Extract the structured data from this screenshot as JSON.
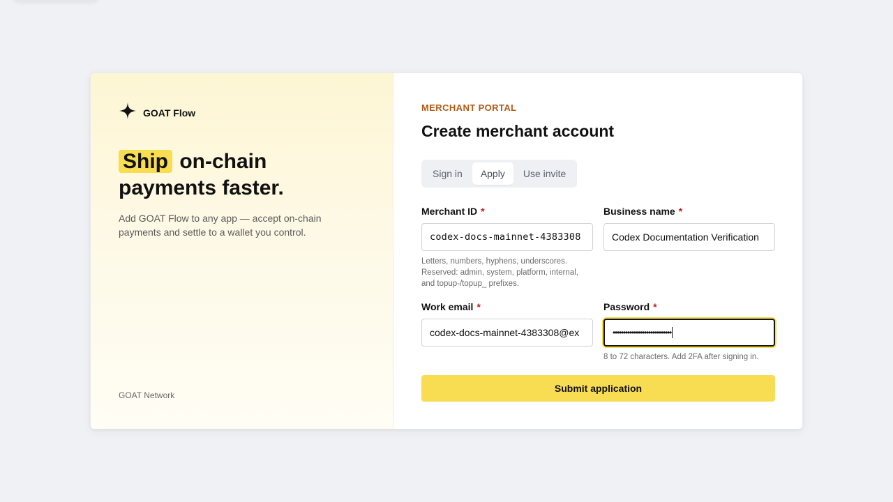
{
  "brand": {
    "name": "GOAT Flow",
    "logo_icon": "sparkle-star-icon"
  },
  "hero": {
    "highlight": "Ship",
    "headline_rest_1": "on-chain",
    "headline_line_2": "payments faster.",
    "subtext": "Add GOAT Flow to any app — accept on-chain payments and settle to a wallet you control.",
    "highlight_color": "#f8dd52"
  },
  "footer": {
    "network": "GOAT Network"
  },
  "form": {
    "eyebrow": "MERCHANT PORTAL",
    "title": "Create merchant account",
    "tabs": [
      {
        "label": "Sign in",
        "active": false
      },
      {
        "label": "Apply",
        "active": true
      },
      {
        "label": "Use invite",
        "active": false
      }
    ],
    "required_mark": "*",
    "merchant_id": {
      "label": "Merchant ID",
      "value": "codex-docs-mainnet-4383308",
      "hint": "Letters, numbers, hyphens, underscores. Reserved: admin, system, platform, internal, and topup-/topup_ prefixes."
    },
    "business_name": {
      "label": "Business name",
      "value": "Codex Documentation Verification"
    },
    "work_email": {
      "label": "Work email",
      "value": "codex-docs-mainnet-4383308@ex"
    },
    "password": {
      "label": "Password",
      "masked_value": "••••••••••••••••••••••••••••",
      "hint": "8 to 72 characters. Add 2FA after signing in."
    },
    "submit_label": "Submit application"
  },
  "colors": {
    "accent": "#f8dd52",
    "eyebrow": "#b35a14",
    "required": "#c02020",
    "background": "#f0f1f4"
  }
}
